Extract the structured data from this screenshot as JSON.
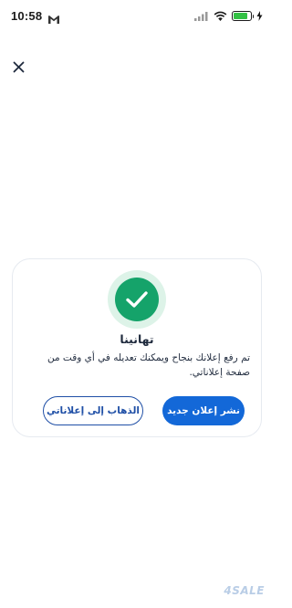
{
  "status_bar": {
    "time": "10:58",
    "battery_level": 0.85,
    "icons": [
      "gmail-icon",
      "signal-icon",
      "wifi-icon",
      "battery-icon",
      "charging-icon"
    ]
  },
  "header": {
    "close_icon": "close-icon"
  },
  "dialog": {
    "icon": "check-icon",
    "title": "تهانينا",
    "message": "تم رفع إعلانك بنجاح ويمكنك تعديله في أي وقت من صفحة إعلاناتي.",
    "primary_button": "نشر إعلان جديد",
    "secondary_button": "الذهاب إلى إعلاناتي"
  },
  "watermark": "4SALE",
  "colors": {
    "primary": "#1368d8",
    "success": "#15a36a",
    "success_halo": "#ddf3e8",
    "text": "#1f2a3d",
    "outline": "#1f4fa6"
  }
}
